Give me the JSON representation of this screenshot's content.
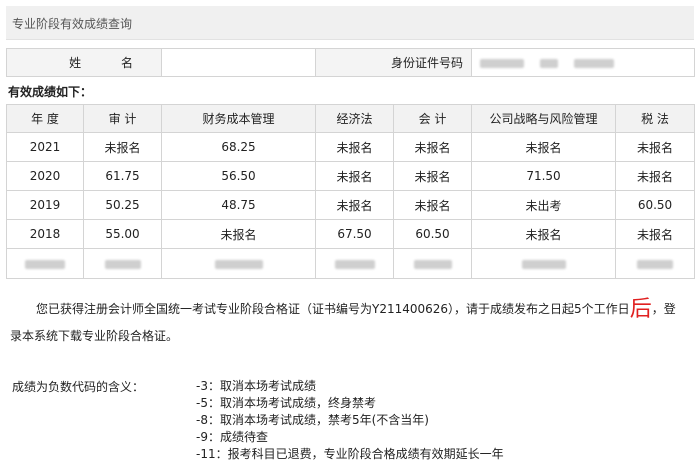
{
  "page": {
    "title": "专业阶段有效成绩查询"
  },
  "identity": {
    "name_label": "姓 名",
    "name_value": "",
    "id_label": "身份证件号码"
  },
  "scores": {
    "section_label": "有效成绩如下：",
    "headers": [
      "年 度",
      "审 计",
      "财务成本管理",
      "经济法",
      "会 计",
      "公司战略与风险管理",
      "税 法"
    ],
    "rows": [
      [
        "2021",
        "未报名",
        "68.25",
        "未报名",
        "未报名",
        "未报名",
        "未报名"
      ],
      [
        "2020",
        "61.75",
        "56.50",
        "未报名",
        "未报名",
        "71.50",
        "未报名"
      ],
      [
        "2019",
        "50.25",
        "48.75",
        "未报名",
        "未报名",
        "未出考",
        "60.50"
      ],
      [
        "2018",
        "55.00",
        "未报名",
        "67.50",
        "60.50",
        "未报名",
        "未报名"
      ]
    ]
  },
  "notice": {
    "part1": "您已获得注册会计师全国统一考试专业阶段合格证（证书编号为Y211400626），请于成绩发布之日起5个工作日",
    "emphasis": "后",
    "part2": "，登录本系统下载专业阶段合格证。"
  },
  "codes": {
    "label": "成绩为负数代码的含义：",
    "items": [
      "-3：取消本场考试成绩",
      "-5：取消本场考试成绩，终身禁考",
      "-8：取消本场考试成绩，禁考5年(不含当年)",
      "-9：成绩待查",
      "-11：报考科目已退费，专业阶段合格成绩有效期延长一年"
    ]
  }
}
